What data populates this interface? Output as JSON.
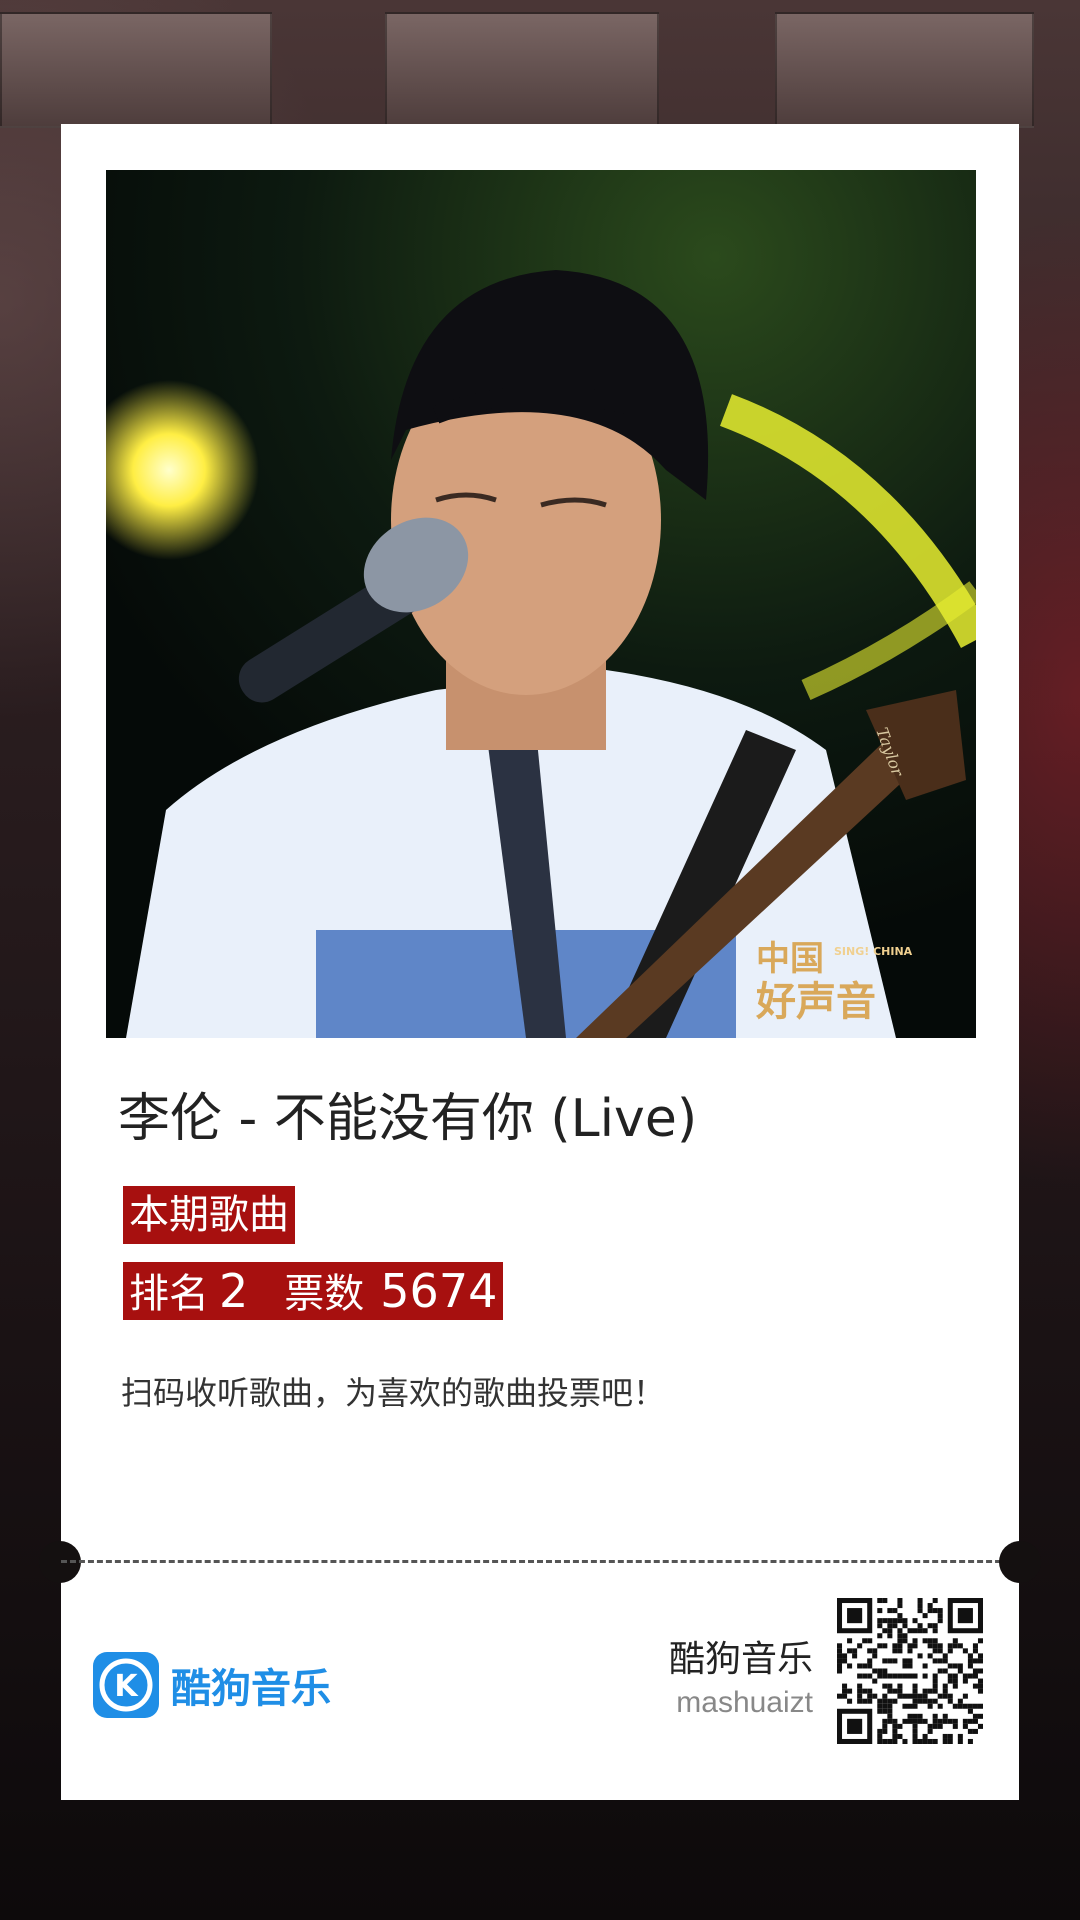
{
  "song": {
    "title": "李伦 - 不能没有你 (Live)"
  },
  "tags": {
    "period_label": "本期歌曲",
    "rank_label": "排名",
    "rank_value": "2",
    "votes_label": "票数",
    "votes_value": "5674"
  },
  "prompt": "扫码收听歌曲，为喜欢的歌曲投票吧！",
  "photo": {
    "watermark_line1": "中国",
    "watermark_line2": "好声音",
    "watermark_small": "SING! CHINA",
    "guitar_brand": "Taylor"
  },
  "footer": {
    "logo_text": "酷狗音乐",
    "logo_letter": "K",
    "brand_name": "酷狗音乐",
    "brand_id": "mashuaizt",
    "qr_icon": "qr-code-icon"
  },
  "colors": {
    "tag_red": "#a7100f",
    "kugou_blue": "#1f8ee6"
  }
}
